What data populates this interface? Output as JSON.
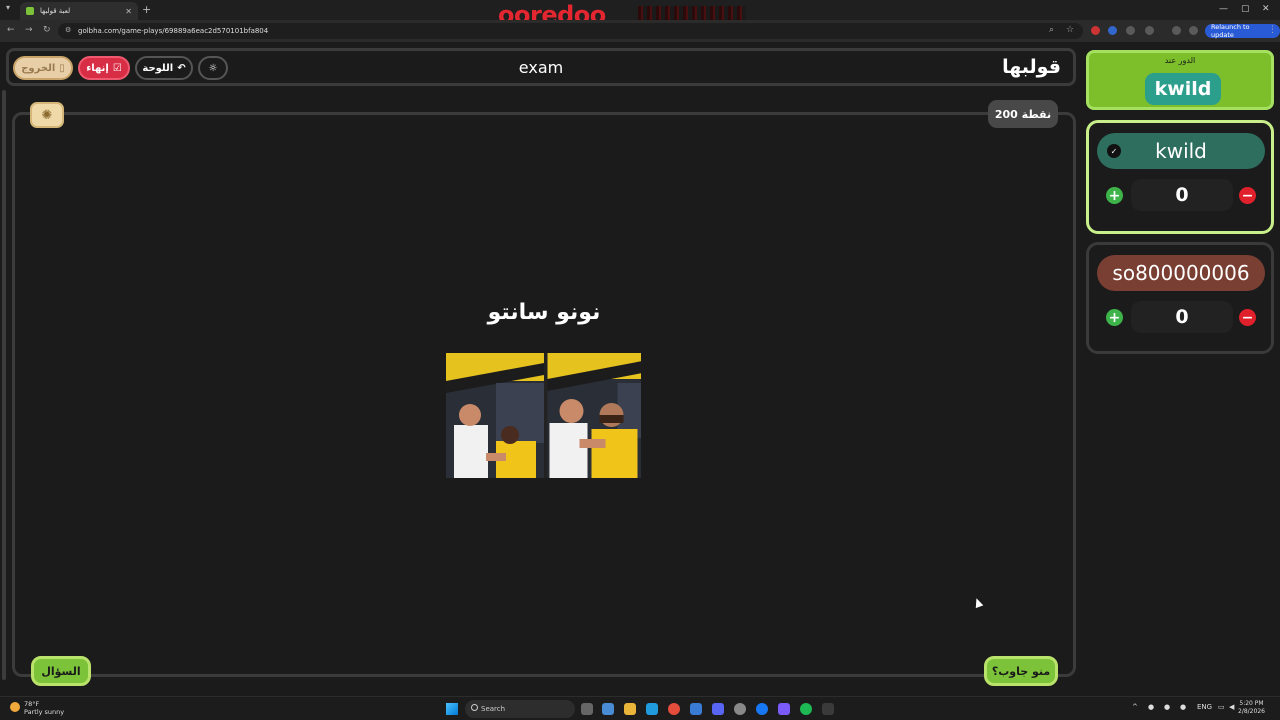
{
  "browser": {
    "tab_title": "لعبة قولبها",
    "new_tab": "+",
    "url": "golbha.com/game-plays/69889a6eac2d570101bfa804",
    "relaunch": "Relaunch to update",
    "banner_brand": "ooredoo"
  },
  "app": {
    "logo": "قولبها",
    "title": "exam",
    "buttons": {
      "exit": "الخروج",
      "end": "إنهاء",
      "board": "اللوحة"
    },
    "points": "200 نقطة",
    "answer": "نونو سانتو",
    "question_button": "السؤال",
    "who_answered_button": "منو جاوب؟"
  },
  "sidebar": {
    "turn_label": "الدور عند",
    "turn_name": "kwild",
    "players": [
      {
        "name": "kwild",
        "score": "0"
      },
      {
        "name": "so800000006",
        "score": "0"
      }
    ]
  },
  "taskbar": {
    "weather_temp": "78°F",
    "weather_desc": "Partly sunny",
    "search": "Search",
    "lang": "ENG",
    "time": "5:20 PM",
    "date": "2/8/2026"
  },
  "colors": {
    "accent_green": "#7cc33a",
    "danger_red": "#d72d45",
    "player1": "#2e6e5e",
    "player2": "#7a3f33",
    "turn_badge": "#2c9e8c"
  }
}
